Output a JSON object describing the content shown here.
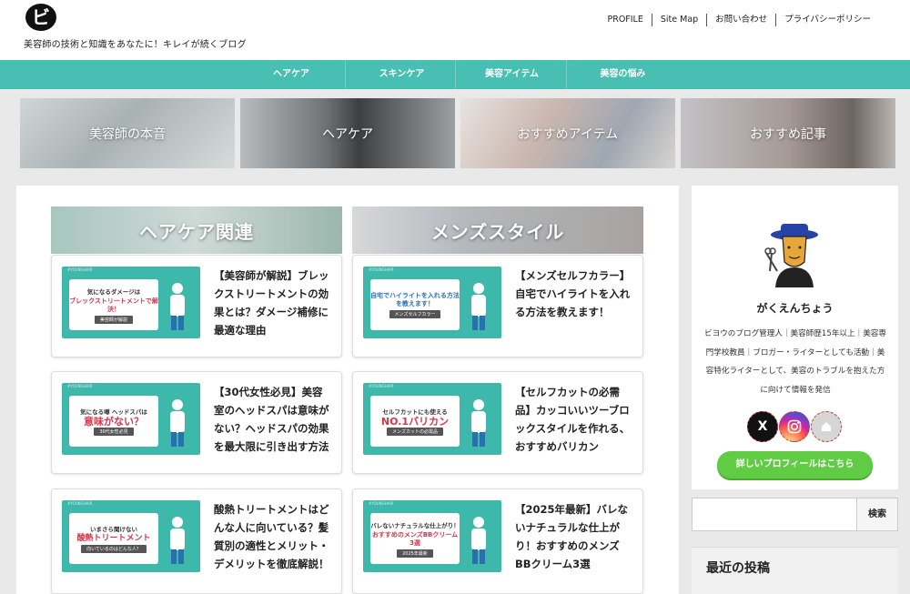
{
  "header": {
    "logo": "ビ",
    "tagline": "美容師の技術と知識をあなたに！キレイが続くブログ",
    "topnav": [
      "PROFILE",
      "Site Map",
      "お問い合わせ",
      "プライバシーポリシー"
    ]
  },
  "mainnav": [
    "ヘアケア",
    "スキンケア",
    "美容アイテム",
    "美容の悩み"
  ],
  "banners": [
    "美容師の本音",
    "ヘアケア",
    "おすすめアイテム",
    "おすすめ記事"
  ],
  "sections": [
    "ヘアケア関連",
    "メンズスタイル"
  ],
  "cards": [
    {
      "title": "【美容師が解説】ブレックストリートメントの効果とは？ダメージ補修に最適な理由",
      "thumb": {
        "strip": "#YOUNGHAIR",
        "l1": "気になるダメージは",
        "l2": "ブレックストリートメントで解決！",
        "l3": "美容師が解説"
      }
    },
    {
      "title": "【メンズセルフカラー】自宅でハイライトを入れる方法を教えます！",
      "thumb": {
        "strip": "#YOUNGHAIR",
        "l1": "",
        "l2": "自宅でハイライトを入れる方法を教えます！",
        "l3": "メンズセルフカラー"
      }
    },
    {
      "title": "【30代女性必見】美容室のヘッドスパは意味がない？ヘッドスパの効果を最大限に引き出す方法",
      "thumb": {
        "strip": "#YOUNGHAIR",
        "l1": "気になる噂 ヘッドスパは",
        "l2": "意味がない？",
        "l3": "30代女性必見"
      }
    },
    {
      "title": "【セルフカットの必需品】カッコいいツーブロックスタイルを作れる、おすすめバリカン",
      "thumb": {
        "strip": "#YOUNGHAIR",
        "l1": "セルフカットにも使える",
        "l2": "NO.1バリカン",
        "l3": "メンズカットの必需品"
      }
    },
    {
      "title": "酸熱トリートメントはどんな人に向いている？髪質別の適性とメリット・デメリットを徹底解説！",
      "thumb": {
        "strip": "#YOUNGHAIR",
        "l1": "いまさら聞けない",
        "l2": "酸熱トリートメント",
        "l3": "向いているのはどんな人？"
      }
    },
    {
      "title": "【2025年最新】バレないナチュラルな仕上がり！おすすめのメンズBBクリーム3選",
      "thumb": {
        "strip": "#YOUNGHAIR",
        "l1": "バレないナチュラルな仕上がり！",
        "l2": "おすすめのメンズBBクリーム3選",
        "l3": "2025年最新"
      }
    }
  ],
  "profile": {
    "name": "がくえんちょう",
    "description": "ビヨウのブログ管理人｜美容師歴15年以上｜美容専門学校教員｜ブロガー・ライターとしても活動｜美容特化ライターとして、美容のトラブルを抱えた方に向けて情報を発信",
    "social": [
      "X",
      "Instagram",
      "Home"
    ],
    "social_icons": {
      "x": "x-icon",
      "instagram": "instagram-icon",
      "home": "home-icon"
    },
    "button": "詳しいプロフィールはこちら"
  },
  "search": {
    "button": "検索",
    "placeholder": ""
  },
  "recent": {
    "title": "最近の投稿"
  },
  "colors": {
    "accent": "#47bfb2",
    "button": "#5fcc44",
    "thumb": "#3fb8ac",
    "highlight": "#d9354b"
  }
}
